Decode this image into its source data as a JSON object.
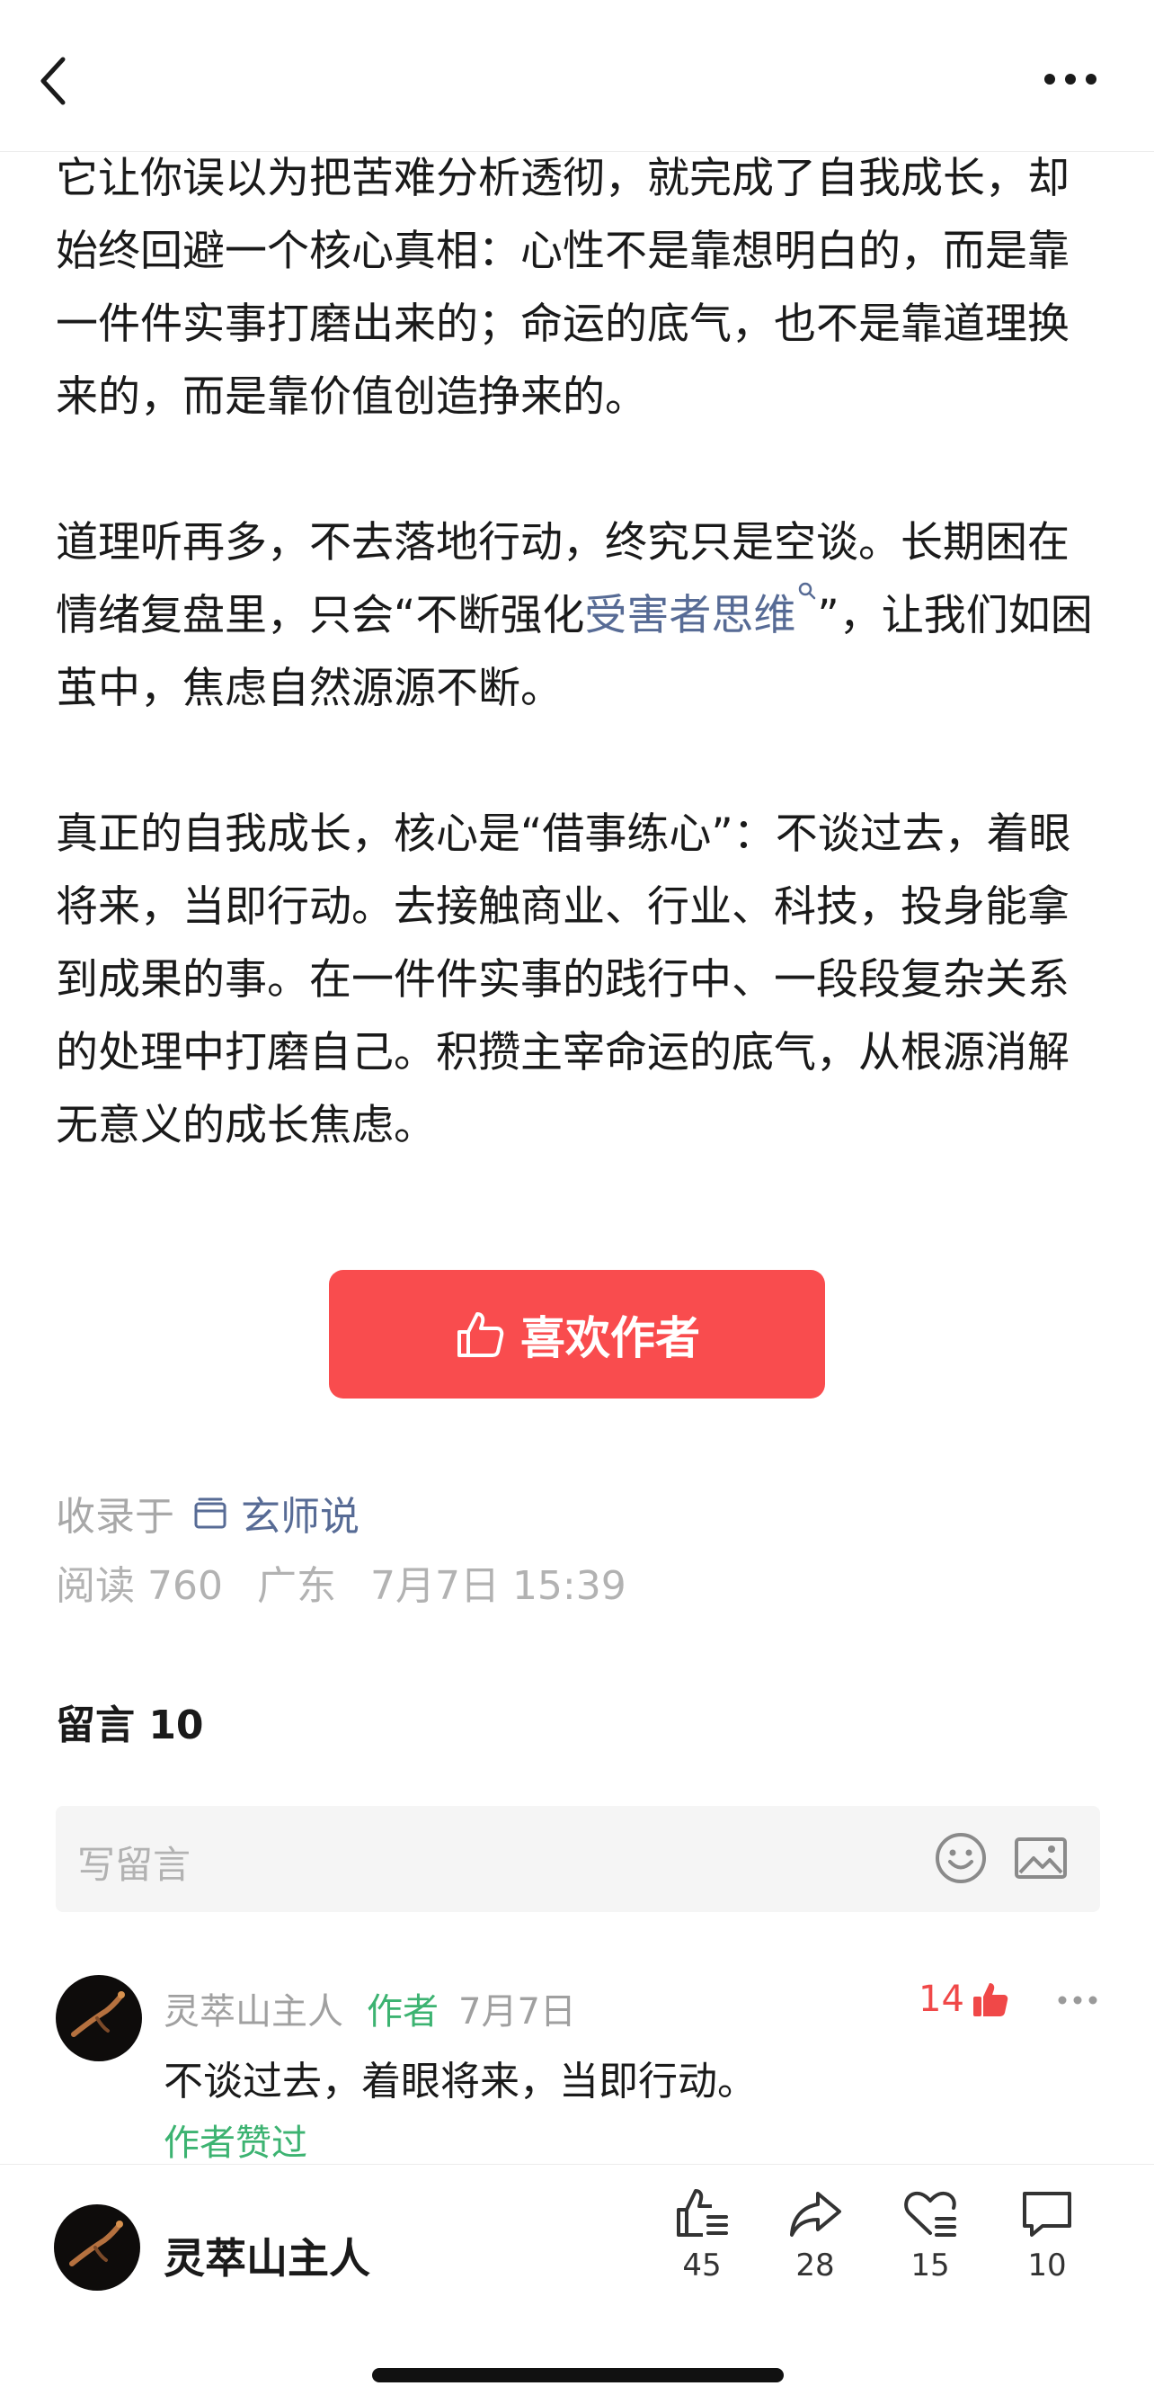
{
  "article": {
    "paragraphs": [
      "它让你误以为把苦难分析透彻，就完成了自我成长，却始终回避一个核心真相：心性不是靠想明白的，而是靠一件件实事打磨出来的；命运的底气，也不是靠道理换来的，而是靠价值创造挣来的。",
      "道理听再多，不去落地行动，终究只是空谈。长期困在情绪复盘里，只会“不断强化",
      "真正的自我成长，核心是“借事练心”：不谈过去，着眼将来，当即行动。去接触商业、行业、科技，投身能拿到成果的事。在一件件实事的践行中、一段段复杂关系的处理中打磨自己。积攒主宰命运的底气，从根源消解无意义的成长焦虑。"
    ],
    "keyword_link": "受害者思维",
    "after_keyword": "”，让我们如困茧中，焦虑自然源源不断。"
  },
  "like_author_button": {
    "label": "喜欢作者"
  },
  "meta": {
    "collected_prefix": "收录于",
    "collection_name": "玄师说",
    "reads": "阅读 760",
    "location": "广东",
    "datetime": "7月7日 15:39"
  },
  "comments": {
    "heading": "留言 10",
    "input_placeholder": "写留言",
    "items": [
      {
        "name": "灵萃山主人",
        "author_tag": "作者",
        "date": "7月7日",
        "likes": "14",
        "text": "不谈过去，着眼将来，当即行动。",
        "author_liked": "作者赞过"
      }
    ]
  },
  "bottom_bar": {
    "author_name": "灵萃山主人",
    "like_count": "45",
    "share_count": "28",
    "favorite_count": "15",
    "comment_count": "10"
  },
  "icons": {
    "back": "back-chevron-icon",
    "more": "more-dots-icon",
    "thumb": "thumbs-up-icon",
    "emoji": "emoji-icon",
    "image": "image-icon",
    "share": "share-arrow-icon",
    "favorite": "heart-icon",
    "comment": "comment-bubble-icon"
  },
  "colors": {
    "accent_red": "#f94c4e",
    "link_blue": "#576b95",
    "author_green": "#3cb371"
  }
}
